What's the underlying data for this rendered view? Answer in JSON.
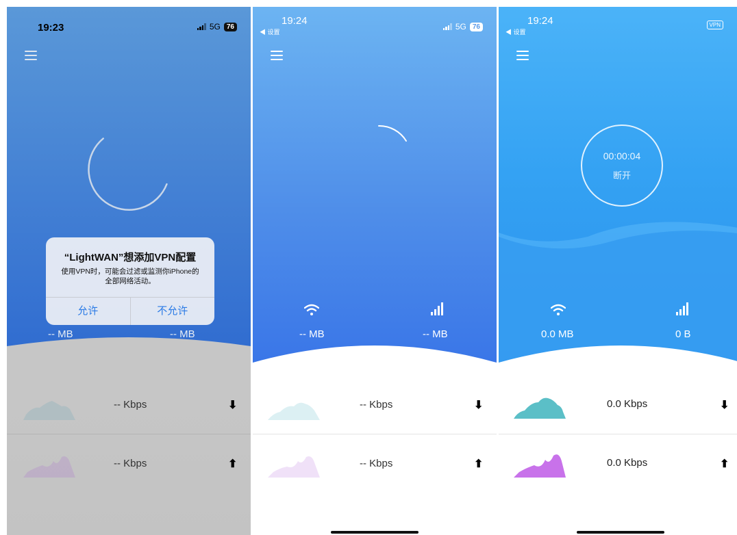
{
  "screens": [
    {
      "status": {
        "time": "19:23",
        "network": "5G",
        "battery": "76"
      },
      "loading": true,
      "dialog": {
        "title": "“LightWAN”想添加VPN配置",
        "message": "使用VPN时，可能会过滤或监测你iPhone的全部网络活动。",
        "allow_label": "允许",
        "deny_label": "不允许"
      },
      "wifi_usage": "-- MB",
      "cellular_usage": "-- MB",
      "download_speed": "-- Kbps",
      "upload_speed": "-- Kbps"
    },
    {
      "status": {
        "time": "19:24",
        "back_label": "◀ 设置",
        "network": "5G",
        "battery": "76"
      },
      "loading": true,
      "wifi_usage": "-- MB",
      "cellular_usage": "-- MB",
      "download_speed": "-- Kbps",
      "upload_speed": "-- Kbps"
    },
    {
      "status": {
        "time": "19:24",
        "back_label": "◀ 设置",
        "vpn_badge": "VPN"
      },
      "timer": "00:00:04",
      "disconnect_label": "断开",
      "wifi_usage": "0.0 MB",
      "cellular_usage": "0 B",
      "download_speed": "0.0 Kbps",
      "upload_speed": "0.0 Kbps"
    }
  ],
  "colors": {
    "download_graph": "#5bbfc7",
    "upload_graph": "#c872ea",
    "dialog_button": "#2b7be6"
  }
}
